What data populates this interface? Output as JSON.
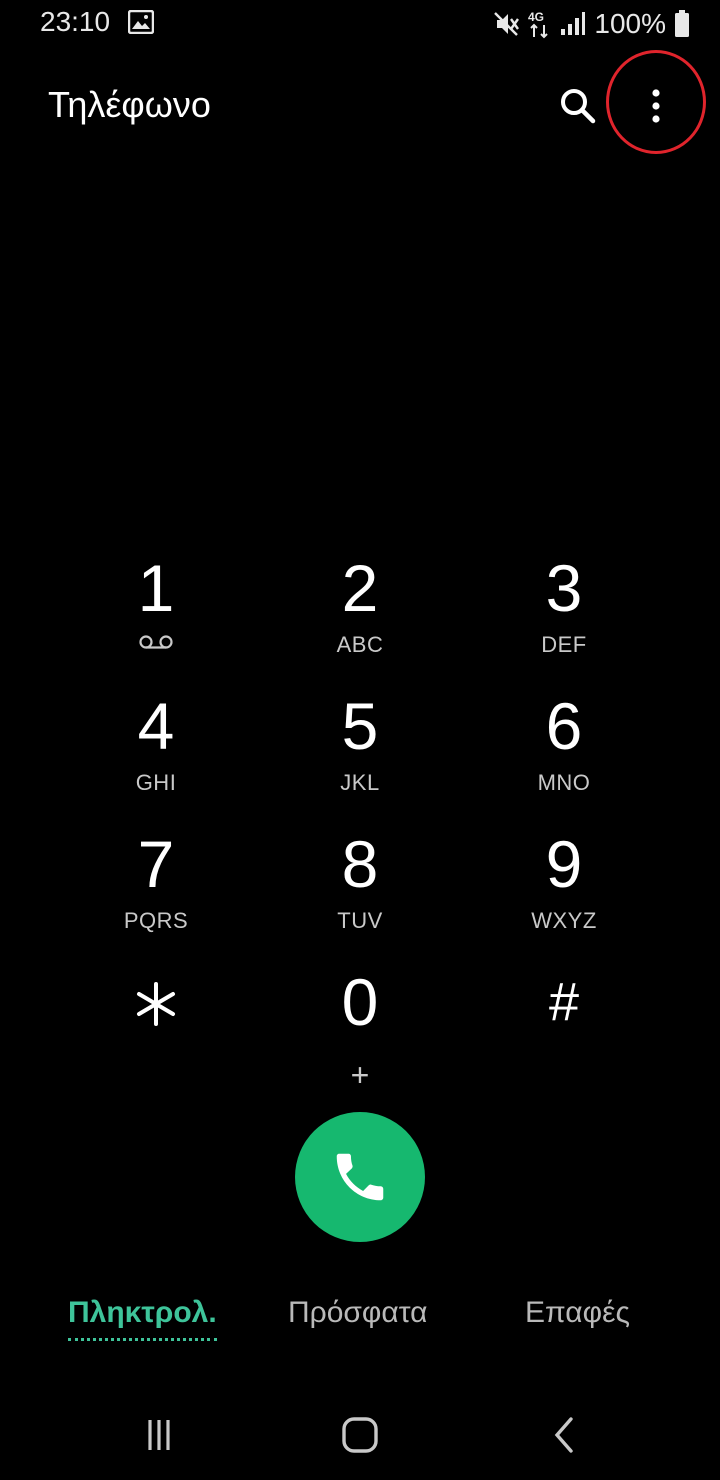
{
  "status_bar": {
    "time": "23:10",
    "battery": "100%",
    "network_type": "4G",
    "icons": [
      "gallery-icon",
      "mute-icon",
      "network-4g-icon",
      "signal-icon",
      "battery-icon"
    ]
  },
  "app_bar": {
    "title": "Τηλέφωνο",
    "search_icon": "search-icon",
    "more_icon": "more-options-icon"
  },
  "keypad": {
    "keys": [
      {
        "digit": "1",
        "letters": "",
        "sub_icon": "voicemail-icon"
      },
      {
        "digit": "2",
        "letters": "ABC"
      },
      {
        "digit": "3",
        "letters": "DEF"
      },
      {
        "digit": "4",
        "letters": "GHI"
      },
      {
        "digit": "5",
        "letters": "JKL"
      },
      {
        "digit": "6",
        "letters": "MNO"
      },
      {
        "digit": "7",
        "letters": "PQRS"
      },
      {
        "digit": "8",
        "letters": "TUV"
      },
      {
        "digit": "9",
        "letters": "WXYZ"
      },
      {
        "digit": "*",
        "letters": ""
      },
      {
        "digit": "0",
        "letters": "+"
      },
      {
        "digit": "#",
        "letters": ""
      }
    ]
  },
  "call_button": {
    "icon": "phone-icon",
    "color": "#16b86f"
  },
  "tabs": [
    {
      "label": "Πληκτρολ.",
      "active": true
    },
    {
      "label": "Πρόσφατα",
      "active": false
    },
    {
      "label": "Επαφές",
      "active": false
    }
  ],
  "nav_bar": {
    "icons": [
      "recent-apps-icon",
      "home-icon",
      "back-icon"
    ]
  },
  "colors": {
    "accent": "#3ec49a",
    "call": "#16b86f",
    "highlight": "#e0242c",
    "background": "#000000"
  }
}
